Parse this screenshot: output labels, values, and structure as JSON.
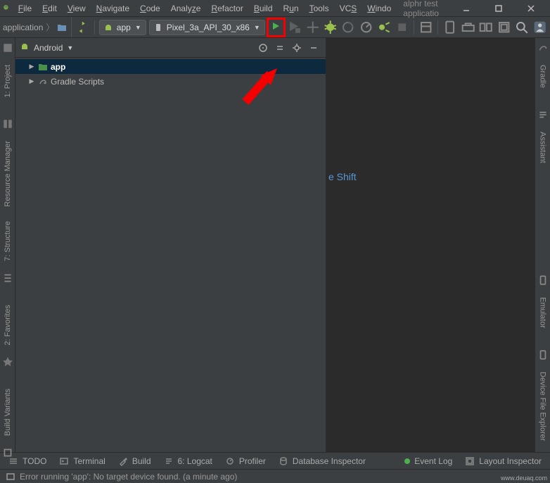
{
  "titlebar": {
    "project_name": "alphr test applicatio"
  },
  "menu": {
    "file": "File",
    "edit": "Edit",
    "view": "View",
    "navigate": "Navigate",
    "code": "Code",
    "analyze": "Analyze",
    "refactor": "Refactor",
    "build": "Build",
    "run": "Run",
    "tools": "Tools",
    "vcs": "VCS",
    "window": "Windo"
  },
  "toolbar": {
    "breadcrumb": "application",
    "config_label": "app",
    "device_label": "Pixel_3a_API_30_x86"
  },
  "project_panel": {
    "view_mode": "Android",
    "tree": {
      "app": "app",
      "gradle_scripts": "Gradle Scripts"
    }
  },
  "left_rail": {
    "project": "1: Project",
    "resource_manager": "Resource Manager",
    "structure": "7: Structure",
    "favorites": "2: Favorites",
    "build_variants": "Build Variants"
  },
  "right_rail": {
    "gradle": "Gradle",
    "assistant": "Assistant",
    "emulator": "Emulator",
    "device_file_explorer": "Device File Explorer"
  },
  "editor": {
    "hint": "e Shift"
  },
  "bottombar": {
    "todo": "TODO",
    "terminal": "Terminal",
    "build": "Build",
    "logcat": "6: Logcat",
    "profiler": "Profiler",
    "database_inspector": "Database Inspector",
    "event_log": "Event Log",
    "layout_inspector": "Layout Inspector"
  },
  "statusbar": {
    "message": "Error running 'app': No target device found. (a minute ago)"
  },
  "watermark": "www.deuaq.com"
}
